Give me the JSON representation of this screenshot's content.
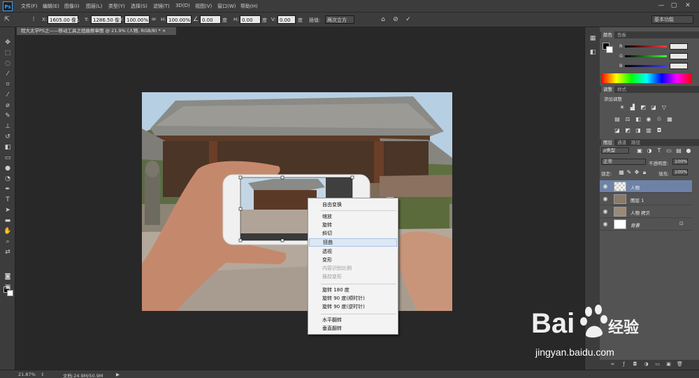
{
  "app": {
    "logo": "Ps"
  },
  "menubar": {
    "items": [
      "文件(F)",
      "编辑(E)",
      "图像(I)",
      "图层(L)",
      "类型(Y)",
      "选择(S)",
      "滤镜(T)",
      "3D(D)",
      "视图(V)",
      "窗口(W)",
      "帮助(H)"
    ],
    "window_controls": [
      "—",
      "▢",
      "✕"
    ]
  },
  "options_bar": {
    "x_label": "X:",
    "x_value": "1605.00 像",
    "y_label": "Y:",
    "y_value": "1286.50 像",
    "w_label": "W:",
    "w_value": "100.00%",
    "h_label": "H:",
    "h_value": "100.00%",
    "angle_value": "0.00",
    "angle_unit": "度",
    "hskew_label": "H:",
    "hskew_value": "0.00",
    "hskew_unit": "度",
    "vskew_label": "V:",
    "vskew_value": "0.00",
    "vskew_unit": "度",
    "interp_label": "插值:",
    "interp_value": "两次立方",
    "workspace": "基本功能"
  },
  "document_tab": {
    "title": "程大太学PS之——移动工具之扭曲侧章图 @ 21.9% (人物, RGB/8) * ×"
  },
  "context_menu": {
    "items": [
      {
        "label": "自由变换",
        "disabled": false
      },
      {
        "label": "缩放",
        "disabled": false
      },
      {
        "label": "旋转",
        "disabled": false
      },
      {
        "label": "斜切",
        "disabled": false
      },
      {
        "label": "扭曲",
        "disabled": false,
        "highlighted": true
      },
      {
        "label": "透视",
        "disabled": false
      },
      {
        "label": "变形",
        "disabled": false
      },
      {
        "label": "内容识别比例",
        "disabled": true
      },
      {
        "label": "操控变形",
        "disabled": true
      },
      {
        "label": "旋转 180 度",
        "disabled": false
      },
      {
        "label": "旋转 90 度(顺时针)",
        "disabled": false
      },
      {
        "label": "旋转 90 度(逆时针)",
        "disabled": false
      },
      {
        "label": "水平翻转",
        "disabled": false
      },
      {
        "label": "垂直翻转",
        "disabled": false
      }
    ]
  },
  "color_panel": {
    "tabs": [
      "颜色",
      "色板"
    ],
    "channels": [
      "R",
      "G",
      "B"
    ],
    "channel_colors": [
      "#ff3b3b",
      "#3bff3b",
      "#3b3bff"
    ]
  },
  "adjust_panel": {
    "tabs": [
      "调整",
      "样式"
    ],
    "heading": "添加调整"
  },
  "layers_panel": {
    "tabs": [
      "图层",
      "通道",
      "路径"
    ],
    "filter_label": "ρ类型",
    "blend_mode": "正常",
    "opacity_label": "不透明度:",
    "opacity_value": "100%",
    "lock_label": "锁定:",
    "fill_label": "填充:",
    "fill_value": "100%",
    "layers": [
      {
        "name": "人物",
        "selected": true,
        "locked": false
      },
      {
        "name": "图层 1",
        "selected": false,
        "locked": false
      },
      {
        "name": "人物 拷贝",
        "selected": false,
        "locked": false
      },
      {
        "name": "背景",
        "selected": false,
        "locked": true
      }
    ]
  },
  "statusbar": {
    "zoom": "21.87%",
    "doc_info": "文档:24.9M/50.9M"
  },
  "watermark": {
    "text": "jingyan.baidu.com"
  }
}
